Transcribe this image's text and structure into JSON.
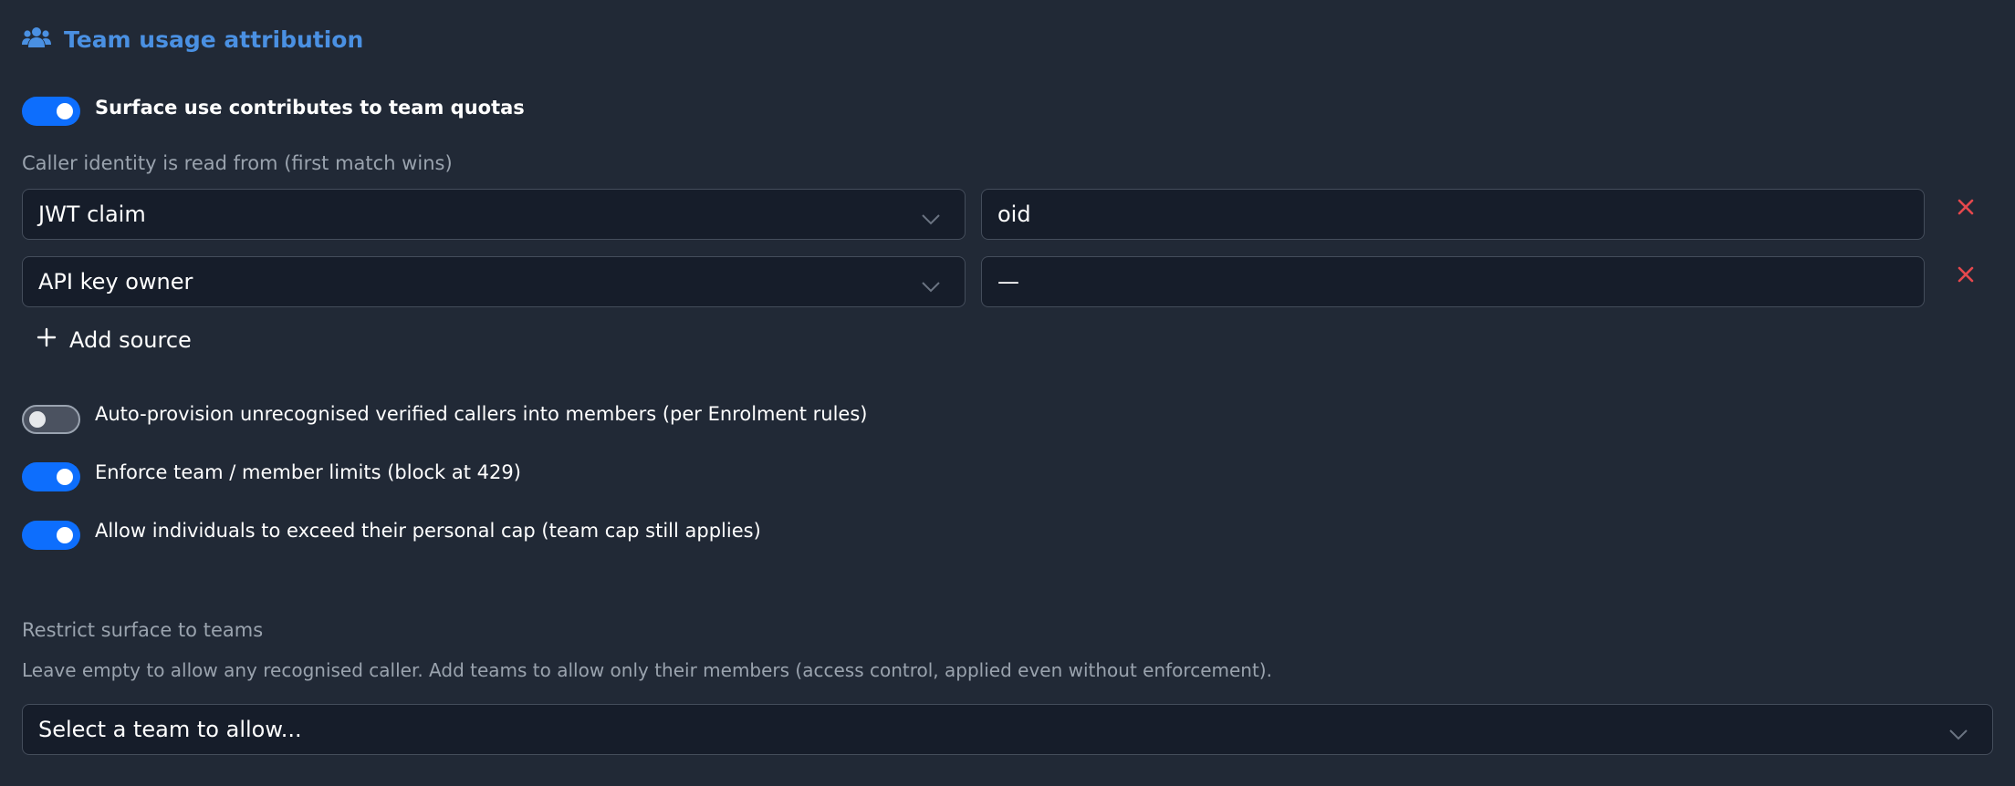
{
  "header": {
    "title": "Team usage attribution",
    "icon": "users-icon",
    "accent_color": "#4a90e2"
  },
  "surface_toggle": {
    "label": "Surface use contributes to team quotas",
    "on": true
  },
  "identity": {
    "label": "Caller identity is read from (first match wins)",
    "sources": [
      {
        "type": "JWT claim",
        "value": "oid"
      },
      {
        "type": "API key owner",
        "value": "—"
      }
    ],
    "add_label": "Add source"
  },
  "options": [
    {
      "label": "Auto-provision unrecognised verified callers into members (per Enrolment rules)",
      "on": false
    },
    {
      "label": "Enforce team / member limits (block at 429)",
      "on": true
    },
    {
      "label": "Allow individuals to exceed their personal cap (team cap still applies)",
      "on": true
    }
  ],
  "restrict": {
    "label": "Restrict surface to teams",
    "hint": "Leave empty to allow any recognised caller. Add teams to allow only their members (access control, applied even without enforcement).",
    "placeholder": "Select a team to allow..."
  },
  "colors": {
    "background": "#212936",
    "toggle_on": "#0d6efd",
    "remove": "#e5484d"
  }
}
